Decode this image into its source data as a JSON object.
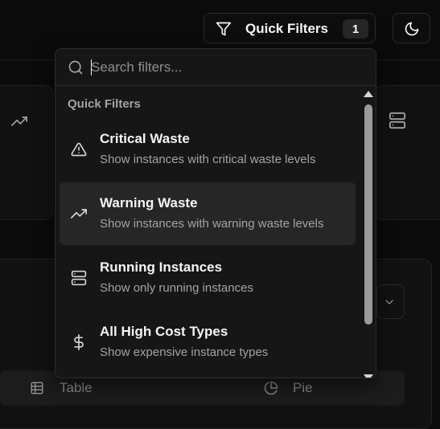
{
  "header": {
    "quick_filters_label": "Quick Filters",
    "quick_filters_count": "1",
    "filter_icon": "filter-funnel-icon",
    "theme_icon": "moon-icon"
  },
  "background": {
    "view_tabs": [
      {
        "label": "Table",
        "icon": "table-icon"
      },
      {
        "label": "Pie",
        "icon": "pie-chart-icon"
      }
    ]
  },
  "dropdown": {
    "search": {
      "placeholder": "Search filters...",
      "value": ""
    },
    "group_label": "Quick Filters",
    "items": [
      {
        "title": "Critical Waste",
        "description": "Show instances with critical waste levels",
        "icon": "alert-triangle-icon",
        "active": false
      },
      {
        "title": "Warning Waste",
        "description": "Show instances with warning waste levels",
        "icon": "trending-up-icon",
        "active": true
      },
      {
        "title": "Running Instances",
        "description": "Show only running instances",
        "icon": "server-icon",
        "active": false
      },
      {
        "title": "All High Cost Types",
        "description": "Show expensive instance types",
        "icon": "dollar-sign-icon",
        "active": false
      }
    ]
  },
  "colors": {
    "background": "#0b0b0b",
    "surface": "#161616",
    "active_item": "#262626",
    "muted_text": "#a3a3a3"
  }
}
